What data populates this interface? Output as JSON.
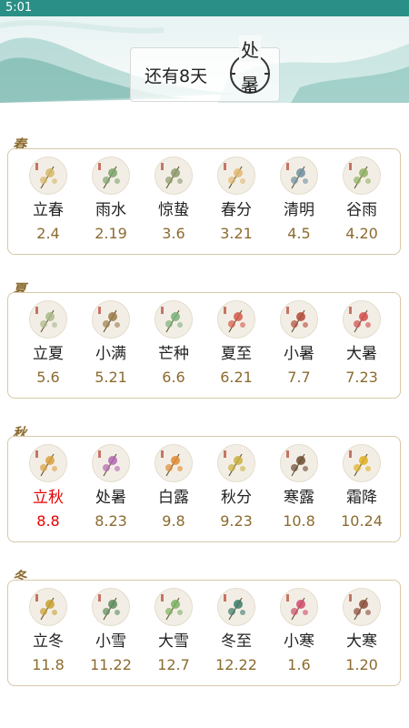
{
  "status_bar": {
    "time": "5:01"
  },
  "countdown": {
    "text": "还有8天",
    "term_char_1": "处",
    "term_char_2": "暑"
  },
  "seasons": [
    {
      "label": "春",
      "terms": [
        {
          "name": "立春",
          "date": "2.4",
          "icon": "plum-blossom-icon",
          "color": "#d6b86a"
        },
        {
          "name": "雨水",
          "date": "2.19",
          "icon": "bamboo-icon",
          "color": "#7aa36a"
        },
        {
          "name": "惊蛰",
          "date": "3.6",
          "icon": "insect-icon",
          "color": "#8a9a6a"
        },
        {
          "name": "春分",
          "date": "3.21",
          "icon": "flower-branch-icon",
          "color": "#e0b870"
        },
        {
          "name": "清明",
          "date": "4.5",
          "icon": "willow-house-icon",
          "color": "#6f8fa0"
        },
        {
          "name": "谷雨",
          "date": "4.20",
          "icon": "tea-leaf-icon",
          "color": "#8fb060"
        }
      ]
    },
    {
      "label": "夏",
      "terms": [
        {
          "name": "立夏",
          "date": "5.6",
          "icon": "rice-dumpling-icon",
          "color": "#a9b88a"
        },
        {
          "name": "小满",
          "date": "5.21",
          "icon": "grain-bowl-icon",
          "color": "#9a7a4a"
        },
        {
          "name": "芒种",
          "date": "6.6",
          "icon": "wheat-icon",
          "color": "#7ab07a"
        },
        {
          "name": "夏至",
          "date": "6.21",
          "icon": "koi-fish-icon",
          "color": "#d25a4a"
        },
        {
          "name": "小暑",
          "date": "7.7",
          "icon": "lychee-icon",
          "color": "#b04a3a"
        },
        {
          "name": "大暑",
          "date": "7.23",
          "icon": "watermelon-icon",
          "color": "#d24a4a"
        }
      ]
    },
    {
      "label": "秋",
      "terms": [
        {
          "name": "立秋",
          "date": "8.8",
          "icon": "chrysanthemum-basket-icon",
          "color": "#d8a040",
          "current": true
        },
        {
          "name": "处暑",
          "date": "8.23",
          "icon": "morning-glory-icon",
          "color": "#b066b0"
        },
        {
          "name": "白露",
          "date": "9.8",
          "icon": "pumpkin-icon",
          "color": "#e08a30"
        },
        {
          "name": "秋分",
          "date": "9.23",
          "icon": "osmanthus-icon",
          "color": "#c9b040"
        },
        {
          "name": "寒露",
          "date": "10.8",
          "icon": "wine-jar-icon",
          "color": "#6a4a30"
        },
        {
          "name": "霜降",
          "date": "10.24",
          "icon": "yellow-chrysanthemum-icon",
          "color": "#e0b020"
        }
      ]
    },
    {
      "label": "冬",
      "terms": [
        {
          "name": "立冬",
          "date": "11.8",
          "icon": "steamer-icon",
          "color": "#c8a030"
        },
        {
          "name": "小雪",
          "date": "11.22",
          "icon": "tea-cup-icon",
          "color": "#5a8a5a"
        },
        {
          "name": "大雪",
          "date": "12.7",
          "icon": "cabbage-icon",
          "color": "#7ab060"
        },
        {
          "name": "冬至",
          "date": "12.22",
          "icon": "teapot-icon",
          "color": "#3a7a6a"
        },
        {
          "name": "小寒",
          "date": "1.6",
          "icon": "red-plum-icon",
          "color": "#d04a6a"
        },
        {
          "name": "大寒",
          "date": "1.20",
          "icon": "hotpot-icon",
          "color": "#8a4a3a"
        }
      ]
    }
  ]
}
